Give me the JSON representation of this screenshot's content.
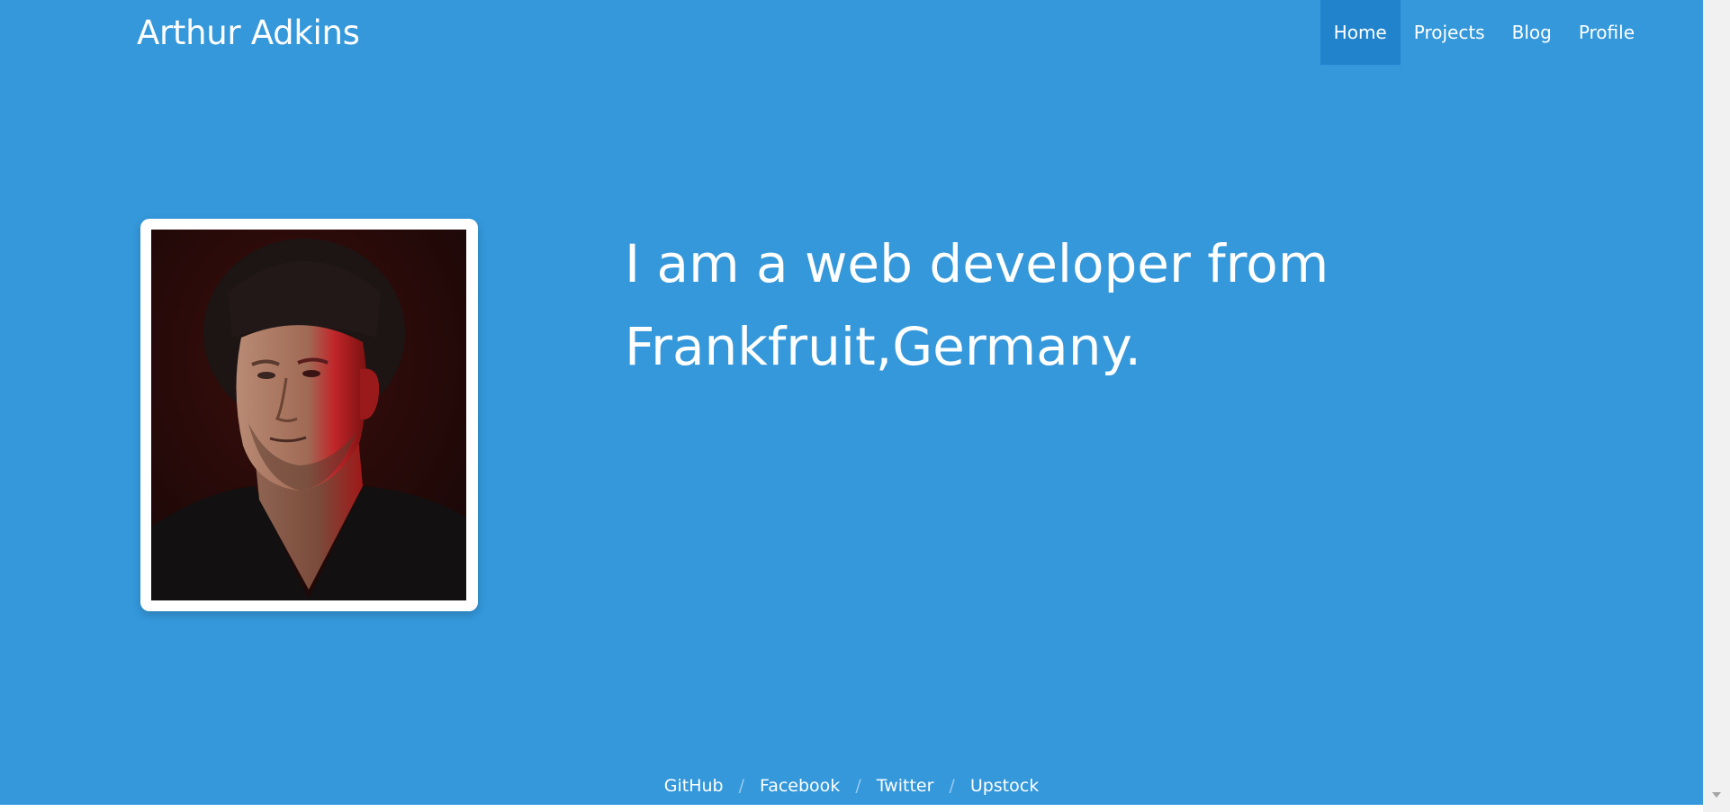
{
  "header": {
    "brand": "Arthur Adkins",
    "nav": [
      {
        "label": "Home",
        "active": true
      },
      {
        "label": "Projects",
        "active": false
      },
      {
        "label": "Blog",
        "active": false
      },
      {
        "label": "Profile",
        "active": false
      }
    ]
  },
  "hero": {
    "tagline_line1": "I am a web developer from",
    "tagline_line2": "Frankfruit,Germany.",
    "photo_icon": "portrait-photo"
  },
  "footer": {
    "links": [
      "GitHub",
      "Facebook",
      "Twitter",
      "Upstock"
    ],
    "separator": "/"
  },
  "colors": {
    "background": "#3498db",
    "nav_active": "#2183cc",
    "text": "#ffffff"
  }
}
